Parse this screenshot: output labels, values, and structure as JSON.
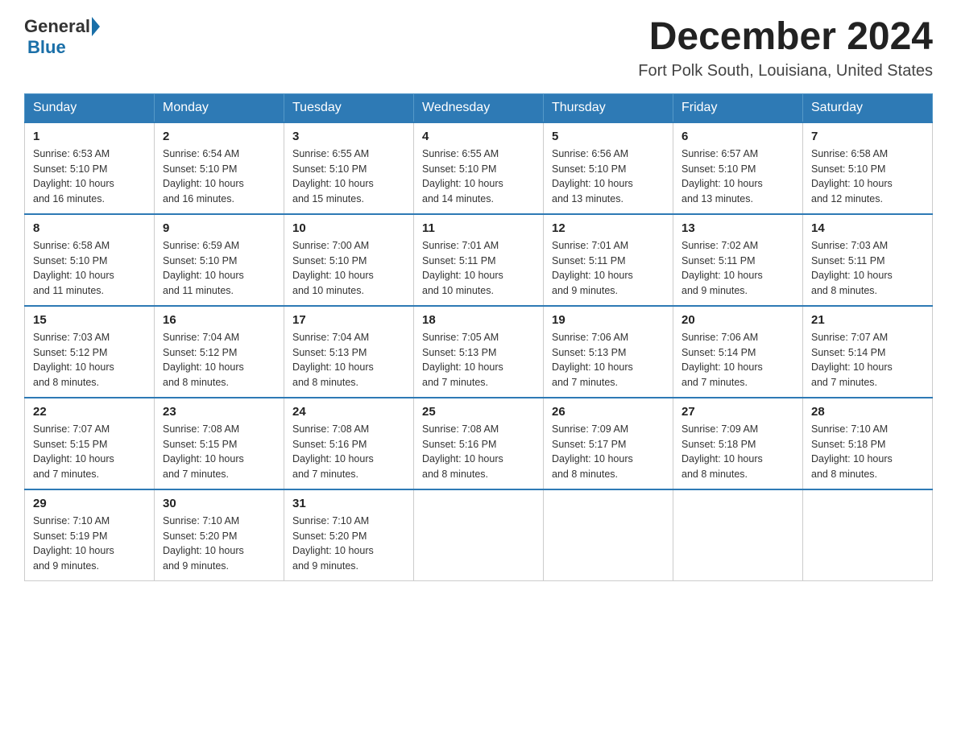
{
  "header": {
    "logo_general": "General",
    "logo_blue": "Blue",
    "month_title": "December 2024",
    "location": "Fort Polk South, Louisiana, United States"
  },
  "days_of_week": [
    "Sunday",
    "Monday",
    "Tuesday",
    "Wednesday",
    "Thursday",
    "Friday",
    "Saturday"
  ],
  "weeks": [
    [
      {
        "day": "1",
        "sunrise": "6:53 AM",
        "sunset": "5:10 PM",
        "daylight": "10 hours and 16 minutes."
      },
      {
        "day": "2",
        "sunrise": "6:54 AM",
        "sunset": "5:10 PM",
        "daylight": "10 hours and 16 minutes."
      },
      {
        "day": "3",
        "sunrise": "6:55 AM",
        "sunset": "5:10 PM",
        "daylight": "10 hours and 15 minutes."
      },
      {
        "day": "4",
        "sunrise": "6:55 AM",
        "sunset": "5:10 PM",
        "daylight": "10 hours and 14 minutes."
      },
      {
        "day": "5",
        "sunrise": "6:56 AM",
        "sunset": "5:10 PM",
        "daylight": "10 hours and 13 minutes."
      },
      {
        "day": "6",
        "sunrise": "6:57 AM",
        "sunset": "5:10 PM",
        "daylight": "10 hours and 13 minutes."
      },
      {
        "day": "7",
        "sunrise": "6:58 AM",
        "sunset": "5:10 PM",
        "daylight": "10 hours and 12 minutes."
      }
    ],
    [
      {
        "day": "8",
        "sunrise": "6:58 AM",
        "sunset": "5:10 PM",
        "daylight": "10 hours and 11 minutes."
      },
      {
        "day": "9",
        "sunrise": "6:59 AM",
        "sunset": "5:10 PM",
        "daylight": "10 hours and 11 minutes."
      },
      {
        "day": "10",
        "sunrise": "7:00 AM",
        "sunset": "5:10 PM",
        "daylight": "10 hours and 10 minutes."
      },
      {
        "day": "11",
        "sunrise": "7:01 AM",
        "sunset": "5:11 PM",
        "daylight": "10 hours and 10 minutes."
      },
      {
        "day": "12",
        "sunrise": "7:01 AM",
        "sunset": "5:11 PM",
        "daylight": "10 hours and 9 minutes."
      },
      {
        "day": "13",
        "sunrise": "7:02 AM",
        "sunset": "5:11 PM",
        "daylight": "10 hours and 9 minutes."
      },
      {
        "day": "14",
        "sunrise": "7:03 AM",
        "sunset": "5:11 PM",
        "daylight": "10 hours and 8 minutes."
      }
    ],
    [
      {
        "day": "15",
        "sunrise": "7:03 AM",
        "sunset": "5:12 PM",
        "daylight": "10 hours and 8 minutes."
      },
      {
        "day": "16",
        "sunrise": "7:04 AM",
        "sunset": "5:12 PM",
        "daylight": "10 hours and 8 minutes."
      },
      {
        "day": "17",
        "sunrise": "7:04 AM",
        "sunset": "5:13 PM",
        "daylight": "10 hours and 8 minutes."
      },
      {
        "day": "18",
        "sunrise": "7:05 AM",
        "sunset": "5:13 PM",
        "daylight": "10 hours and 7 minutes."
      },
      {
        "day": "19",
        "sunrise": "7:06 AM",
        "sunset": "5:13 PM",
        "daylight": "10 hours and 7 minutes."
      },
      {
        "day": "20",
        "sunrise": "7:06 AM",
        "sunset": "5:14 PM",
        "daylight": "10 hours and 7 minutes."
      },
      {
        "day": "21",
        "sunrise": "7:07 AM",
        "sunset": "5:14 PM",
        "daylight": "10 hours and 7 minutes."
      }
    ],
    [
      {
        "day": "22",
        "sunrise": "7:07 AM",
        "sunset": "5:15 PM",
        "daylight": "10 hours and 7 minutes."
      },
      {
        "day": "23",
        "sunrise": "7:08 AM",
        "sunset": "5:15 PM",
        "daylight": "10 hours and 7 minutes."
      },
      {
        "day": "24",
        "sunrise": "7:08 AM",
        "sunset": "5:16 PM",
        "daylight": "10 hours and 7 minutes."
      },
      {
        "day": "25",
        "sunrise": "7:08 AM",
        "sunset": "5:16 PM",
        "daylight": "10 hours and 8 minutes."
      },
      {
        "day": "26",
        "sunrise": "7:09 AM",
        "sunset": "5:17 PM",
        "daylight": "10 hours and 8 minutes."
      },
      {
        "day": "27",
        "sunrise": "7:09 AM",
        "sunset": "5:18 PM",
        "daylight": "10 hours and 8 minutes."
      },
      {
        "day": "28",
        "sunrise": "7:10 AM",
        "sunset": "5:18 PM",
        "daylight": "10 hours and 8 minutes."
      }
    ],
    [
      {
        "day": "29",
        "sunrise": "7:10 AM",
        "sunset": "5:19 PM",
        "daylight": "10 hours and 9 minutes."
      },
      {
        "day": "30",
        "sunrise": "7:10 AM",
        "sunset": "5:20 PM",
        "daylight": "10 hours and 9 minutes."
      },
      {
        "day": "31",
        "sunrise": "7:10 AM",
        "sunset": "5:20 PM",
        "daylight": "10 hours and 9 minutes."
      },
      null,
      null,
      null,
      null
    ]
  ],
  "labels": {
    "sunrise": "Sunrise:",
    "sunset": "Sunset:",
    "daylight": "Daylight:"
  }
}
